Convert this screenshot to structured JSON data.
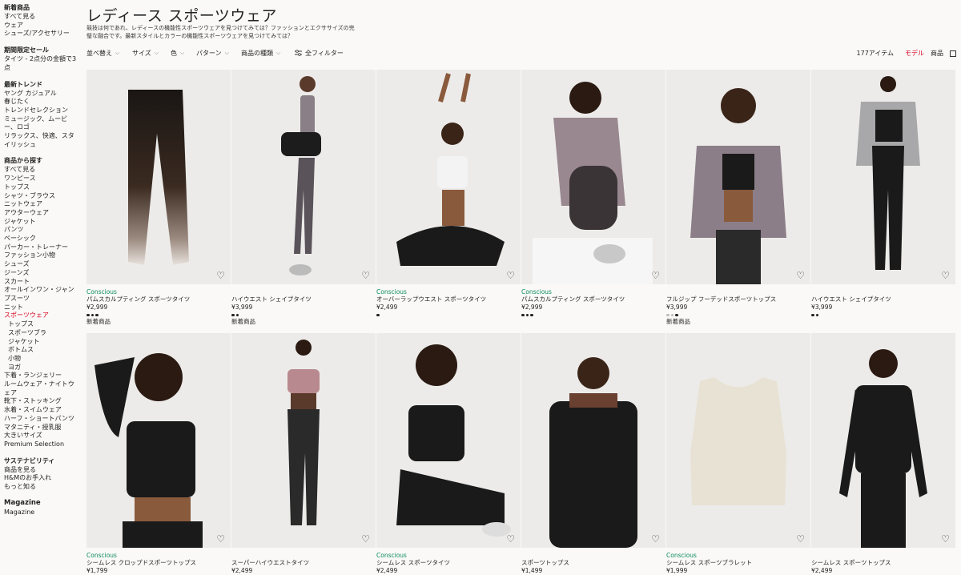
{
  "sidebar": {
    "sections": [
      {
        "heading": "新着商品",
        "items": [
          "すべて見る",
          "ウェア",
          "シューズ/アクセサリー"
        ]
      },
      {
        "heading": "期間限定セール",
        "items": [
          "タイツ - 2点分の金額で3点"
        ]
      },
      {
        "heading": "最新トレンド",
        "items": [
          "ヤング カジュアル",
          "春じたく",
          "トレンドセレクション",
          "ミュージック、ムービー、ロゴ",
          "リラックス、快適、スタイリッシュ"
        ]
      },
      {
        "heading": "商品から探す",
        "items": [
          "すべて見る",
          "ワンピース",
          "トップス",
          "シャツ・ブラウス",
          "ニットウェア",
          "アウターウェア",
          "ジャケット",
          "パンツ",
          "ベーシック",
          "パーカー・トレーナー",
          "ファッション小物",
          "シューズ",
          "ジーンズ",
          "スカート",
          "オールインワン・ジャンプスーツ",
          "ニット",
          "スポーツウェア"
        ],
        "sub": [
          "トップス",
          "スポーツブラ",
          "ジャケット",
          "ボトムス",
          "小物",
          "ヨガ"
        ],
        "after": [
          "下着・ランジェリー",
          "ルームウェア・ナイトウェア",
          "靴下・ストッキング",
          "水着・スイムウェア",
          "ハーフ・ショートパンツ",
          "マタニティ・授乳服",
          "大きいサイズ",
          "Premium Selection"
        ]
      },
      {
        "heading": "サステナビリティ",
        "items": [
          "商品を見る",
          "H&Mのお手入れ",
          "もっと知る"
        ]
      },
      {
        "heading": "Magazine",
        "items": [
          "Magazine"
        ]
      }
    ],
    "active_item": "スポーツウェア"
  },
  "page": {
    "title": "レディース スポーツウェア",
    "description": "競技は何であれ、レディースの機能性スポーツウェアを見つけてみては？ファッションとエクササイズの完璧な融合です。最新スタイルとカラーの機能性スポーツウェアを見つけてみては？"
  },
  "toolbar": {
    "sort": "並べ替え",
    "size": "サイズ",
    "color": "色",
    "pattern": "パターン",
    "type": "商品の種類",
    "all_filters": "全フィルター",
    "count": "177アイテム",
    "model": "モデル",
    "product": "商品"
  },
  "products": [
    {
      "conscious": "Conscious",
      "name": "パムスカルプティング スポーツタイツ",
      "price": "¥2,999",
      "swatches": [
        "dark",
        "dark",
        "dark"
      ],
      "badge": "新着商品"
    },
    {
      "conscious": "",
      "name": "ハイウエスト シェイプタイツ",
      "price": "¥3,999",
      "swatches": [
        "dark",
        "dark"
      ],
      "badge": "新着商品"
    },
    {
      "conscious": "Conscious",
      "name": "オーバーラップウエスト スポーツタイツ",
      "price": "¥2,499",
      "swatches": [
        "dark"
      ],
      "badge": ""
    },
    {
      "conscious": "Conscious",
      "name": "パムスカルプティング スポーツタイツ",
      "price": "¥2,999",
      "swatches": [
        "dark",
        "dark",
        "dark"
      ],
      "badge": ""
    },
    {
      "conscious": "",
      "name": "フルジップ フーデッドスポーツトップス",
      "price": "¥3,999",
      "swatches": [
        "light",
        "light",
        "dark"
      ],
      "badge": "新着商品"
    },
    {
      "conscious": "",
      "name": "ハイウエスト シェイプタイツ",
      "price": "¥3,999",
      "swatches": [
        "dark",
        "dark"
      ],
      "badge": ""
    },
    {
      "conscious": "Conscious",
      "name": "シームレス クロップドスポーツトップス",
      "price": "¥1,799",
      "swatches": [],
      "badge": ""
    },
    {
      "conscious": "",
      "name": "スーパーハイウエストタイツ",
      "price": "¥2,499",
      "swatches": [],
      "badge": ""
    },
    {
      "conscious": "Conscious",
      "name": "シームレス スポーツタイツ",
      "price": "¥2,499",
      "swatches": [],
      "badge": ""
    },
    {
      "conscious": "",
      "name": "スポーツトップス",
      "price": "¥1,499",
      "swatches": [],
      "badge": ""
    },
    {
      "conscious": "Conscious",
      "name": "シームレス スポーツブラレット",
      "price": "¥1,999",
      "swatches": [],
      "badge": ""
    },
    {
      "conscious": "",
      "name": "シームレス スポーツトップス",
      "price": "¥2,499",
      "swatches": [],
      "badge": ""
    }
  ],
  "icons": {
    "heart": "heart-icon",
    "filter": "filter-icon",
    "chevron": "chevron-down-icon"
  },
  "colors": {
    "accent": "#d6001c",
    "conscious": "#0a8a5a",
    "background": "#faf9f8"
  }
}
